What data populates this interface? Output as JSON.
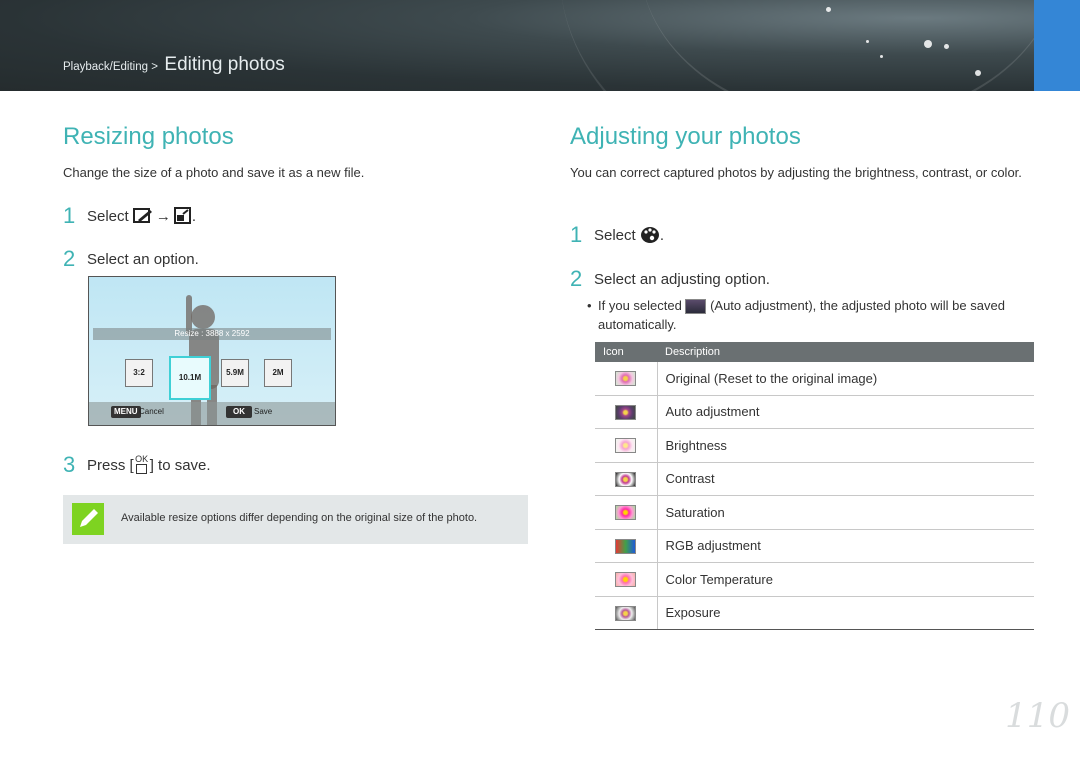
{
  "header": {
    "breadcrumb_small": "Playback/Editing >",
    "breadcrumb_big": "Editing photos",
    "tab_color": "#3486d6"
  },
  "left": {
    "title": "Resizing photos",
    "intro": "Change the size of a photo and save it as a new file.",
    "step1_num": "1",
    "step1_text": "Select",
    "step1_arrow": "→",
    "step1_end": ".",
    "step2_num": "2",
    "step2_text": "Select an option.",
    "screen": {
      "resize_label": "Resize : 3888 x 2592",
      "options": [
        "3:2",
        "10.1M",
        "5.9M",
        "2M"
      ],
      "menu_key": "MENU",
      "cancel": "Cancel",
      "ok_key": "OK",
      "save": "Save"
    },
    "step3_num": "3",
    "step3_pre": "Press [",
    "step3_key": "OK",
    "step3_post": "] to save.",
    "note": "Available resize options differ depending on the original size of the photo."
  },
  "right": {
    "title": "Adjusting your photos",
    "intro": "You can correct captured photos by adjusting the brightness, contrast, or color.",
    "step1_num": "1",
    "step1_text": "Select",
    "step1_end": ".",
    "step2_num": "2",
    "step2_text": "Select an adjusting option.",
    "bullet_pre": "If you selected",
    "bullet_post": "(Auto adjustment), the adjusted photo will be saved automatically.",
    "table": {
      "headers": [
        "Icon",
        "Description"
      ],
      "rows": [
        {
          "icon": "original-icon",
          "desc": "Original (Reset to the original image)"
        },
        {
          "icon": "auto-adjust-icon",
          "desc": "Auto adjustment"
        },
        {
          "icon": "brightness-icon",
          "desc": "Brightness"
        },
        {
          "icon": "contrast-icon",
          "desc": "Contrast"
        },
        {
          "icon": "saturation-icon",
          "desc": "Saturation"
        },
        {
          "icon": "rgb-icon",
          "desc": "RGB adjustment"
        },
        {
          "icon": "color-temp-icon",
          "desc": "Color Temperature"
        },
        {
          "icon": "exposure-icon",
          "desc": "Exposure"
        }
      ]
    }
  },
  "page_number": "110",
  "accent_color": "#3fb3b4"
}
